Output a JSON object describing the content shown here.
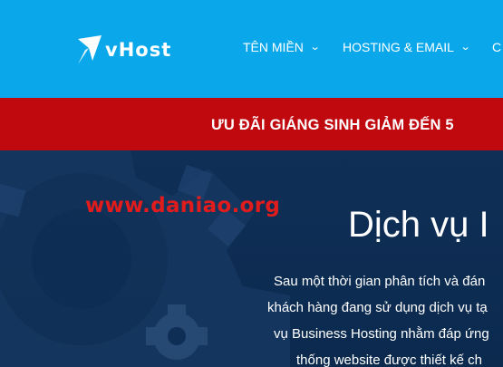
{
  "header": {
    "logo_text": "vHost",
    "nav": [
      {
        "label": "TÊN MIỀN",
        "icon": "chevron-down-icon"
      },
      {
        "label": "HOSTING & EMAIL",
        "icon": "chevron-down-icon"
      },
      {
        "label": "C",
        "icon": ""
      }
    ]
  },
  "promo": {
    "text": "ƯU ĐÃI GIÁNG SINH GIẢM ĐẾN 5"
  },
  "hero": {
    "watermark": "www.daniao.org",
    "title": "Dịch vụ I",
    "description_lines": [
      "Sau một thời gian phân tích và đán",
      "khách hàng đang sử dụng dịch vụ tạ",
      "vụ Business Hosting nhằm đáp ứng",
      "thống website được thiết kế ch"
    ]
  },
  "colors": {
    "header_bg": "#0aa8ea",
    "promo_bg": "#c0090f",
    "hero_bg": "#0e2d55",
    "watermark": "#e01c1c"
  }
}
